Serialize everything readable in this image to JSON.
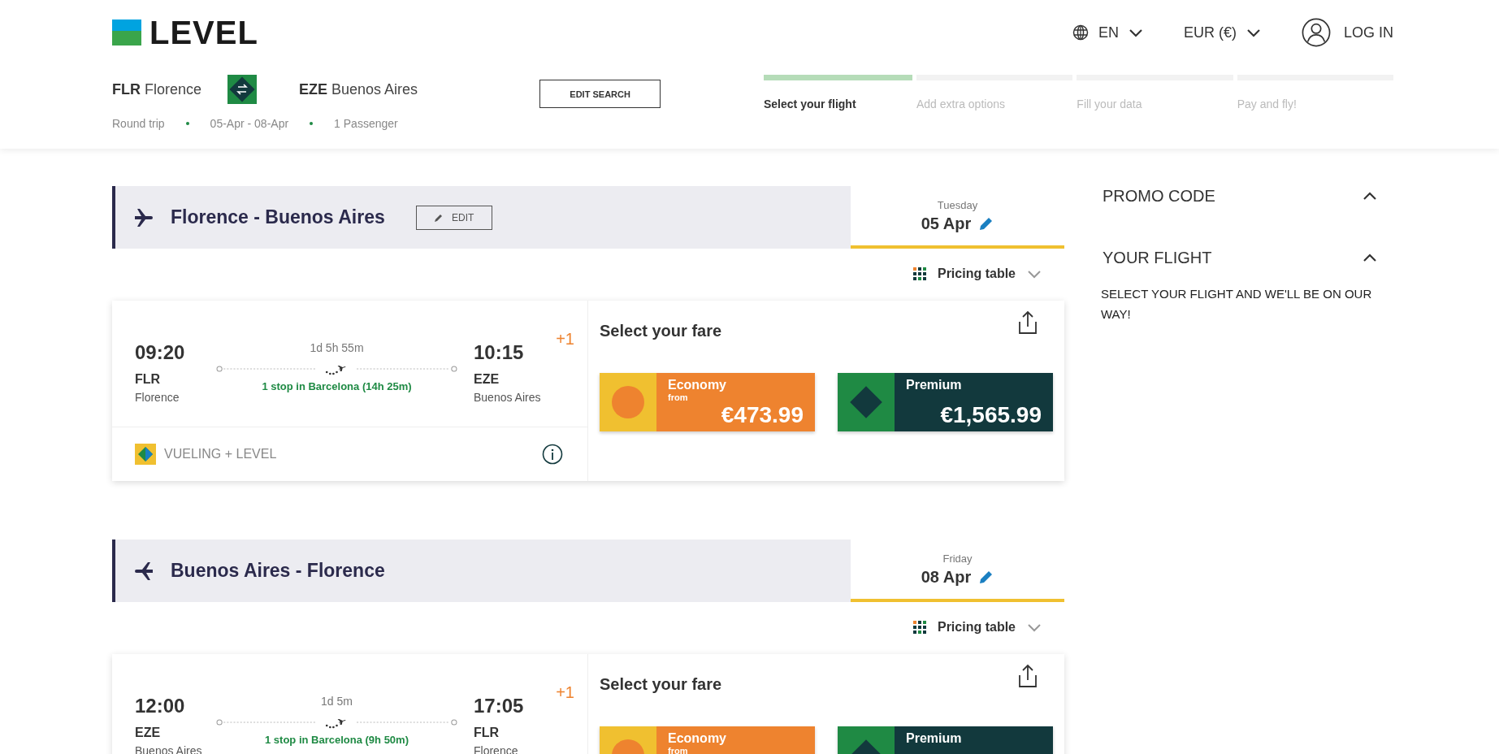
{
  "logo": {
    "text": "LEVEL"
  },
  "header": {
    "language": "EN",
    "currency": "EUR (€)",
    "login": "LOG IN"
  },
  "search": {
    "origin": {
      "code": "FLR",
      "city": "Florence"
    },
    "destination": {
      "code": "EZE",
      "city": "Buenos Aires"
    },
    "details": [
      "Round trip",
      "05-Apr - 08-Apr",
      "1 Passenger"
    ],
    "edit_button": "EDIT SEARCH"
  },
  "steps": [
    {
      "label": "Select your flight",
      "selected": true
    },
    {
      "label": "Add extra options",
      "selected": false
    },
    {
      "label": "Fill your data",
      "selected": false
    },
    {
      "label": "Pay and fly!",
      "selected": false
    }
  ],
  "segments": [
    {
      "kind": "outbound",
      "route": "Florence - Buenos Aires",
      "edit_button": "EDIT",
      "day": "Tuesday",
      "date": "05 Apr",
      "pricing_toggle": "Pricing table",
      "flight": {
        "departure_time": "09:20",
        "departure_code": "FLR",
        "departure_city": "Florence",
        "duration": "1d 5h 55m",
        "stops": "1 stop in Barcelona (14h 25m)",
        "arrival_time": "10:15",
        "day_offset": "+1",
        "arrival_code": "EZE",
        "arrival_city": "Buenos Aires",
        "carrier": "VUELING + LEVEL",
        "fare_title": "Select your fare",
        "fares": [
          {
            "kind": "economy",
            "name": "Economy",
            "from": "from",
            "price": "€473.99"
          },
          {
            "kind": "premium",
            "name": "Premium",
            "price": "€1,565.99"
          }
        ]
      }
    },
    {
      "kind": "return",
      "route": "Buenos Aires - Florence",
      "day": "Friday",
      "date": "08 Apr",
      "pricing_toggle": "Pricing table",
      "flight": {
        "departure_time": "12:00",
        "departure_code": "EZE",
        "departure_city": "Buenos Aires",
        "duration": "1d 5m",
        "stops": "1 stop in Barcelona (9h 50m)",
        "arrival_time": "17:05",
        "day_offset": "+1",
        "arrival_code": "FLR",
        "arrival_city": "Florence",
        "fare_title": "Select your fare",
        "fares": [
          {
            "kind": "economy",
            "name": "Economy",
            "from": "from"
          },
          {
            "kind": "premium",
            "name": "Premium"
          }
        ]
      }
    }
  ],
  "sidebar": {
    "sections": [
      {
        "title": "PROMO CODE",
        "expanded": true
      },
      {
        "title": "YOUR FLIGHT",
        "expanded": true,
        "text": "SELECT YOUR FLIGHT AND WE'LL BE ON OUR WAY!"
      }
    ]
  }
}
